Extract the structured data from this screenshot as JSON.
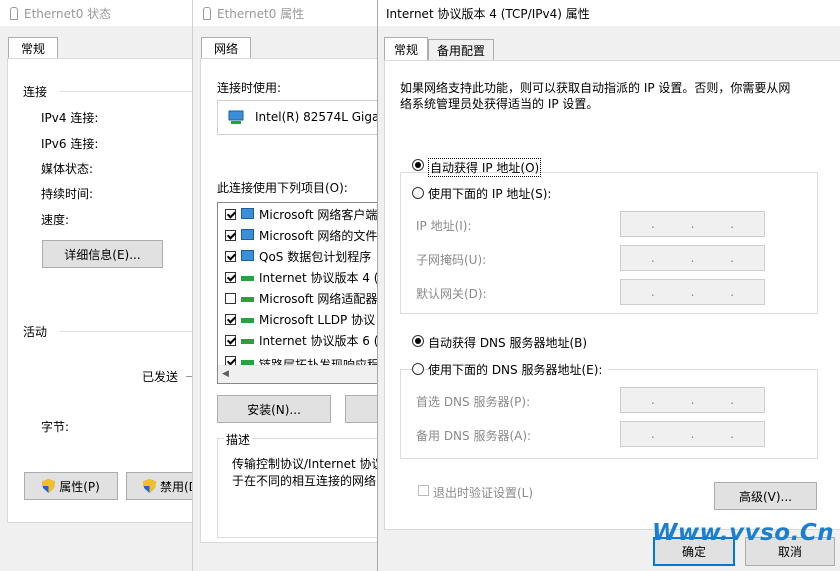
{
  "status_window": {
    "title": "Ethernet0 状态",
    "tab": "常规",
    "connection_heading": "连接",
    "fields": [
      "IPv4 连接:",
      "IPv6 连接:",
      "媒体状态:",
      "持续时间:",
      "速度:"
    ],
    "details_button": "详细信息(E)...",
    "activity_heading": "活动",
    "sent_label": "已发送",
    "bytes_label": "字节:",
    "properties_button": "属性(P)",
    "disable_button": "禁用(D"
  },
  "props_window": {
    "title": "Ethernet0 属性",
    "tab": "网络",
    "connect_using_label": "连接时使用:",
    "adapter_name": "Intel(R) 82574L Gigab",
    "items_label": "此连接使用下列项目(O):",
    "items": [
      {
        "label": "Microsoft 网络客户端",
        "checked": true
      },
      {
        "label": "Microsoft 网络的文件",
        "checked": true
      },
      {
        "label": "QoS 数据包计划程序",
        "checked": true
      },
      {
        "label": "Internet 协议版本 4 (",
        "checked": true
      },
      {
        "label": "Microsoft 网络适配器",
        "checked": false
      },
      {
        "label": "Microsoft LLDP 协议",
        "checked": true
      },
      {
        "label": "Internet 协议版本 6 (",
        "checked": true
      },
      {
        "label": "链路层拓扑发现响应程",
        "checked": true
      }
    ],
    "install_button": "安装(N)...",
    "description_heading": "描述",
    "description_text_1": "传输控制协议/Internet 协议",
    "description_text_2": "于在不同的相互连接的网络"
  },
  "ipv4_window": {
    "title": "Internet 协议版本 4 (TCP/IPv4) 属性",
    "tabs": [
      "常规",
      "备用配置"
    ],
    "intro_1": "如果网络支持此功能，则可以获取自动指派的 IP 设置。否则，你需要从网",
    "intro_2": "络系统管理员处获得适当的 IP 设置。",
    "auto_ip": "自动获得 IP 地址(O)",
    "manual_ip": "使用下面的 IP 地址(S):",
    "ip_address": "IP 地址(I):",
    "subnet_mask": "子网掩码(U):",
    "default_gateway": "默认网关(D):",
    "auto_dns": "自动获得 DNS 服务器地址(B)",
    "manual_dns": "使用下面的 DNS 服务器地址(E):",
    "preferred_dns": "首选 DNS 服务器(P):",
    "alternate_dns": "备用 DNS 服务器(A):",
    "validate_on_exit": "退出时验证设置(L)",
    "advanced_button": "高级(V)...",
    "ok_button": "确定",
    "cancel_button": "取消",
    "ip_dots": "."
  },
  "watermark": "Www.vvso.Cn"
}
